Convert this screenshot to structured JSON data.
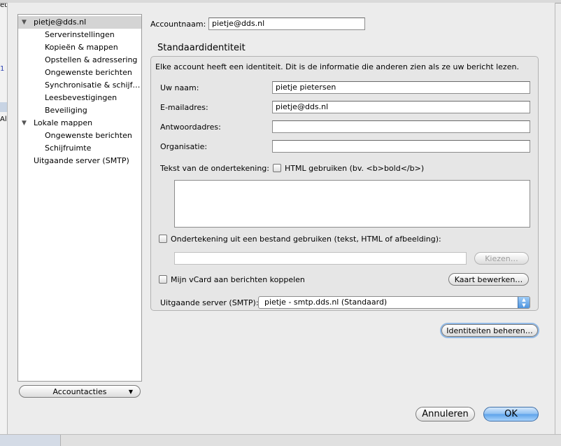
{
  "background": {
    "fragments": [
      "1",
      "All",
      "et"
    ]
  },
  "sidebar": {
    "items": [
      {
        "label": "pietje@dds.nl",
        "level": 0,
        "expanded": true,
        "selected": true
      },
      {
        "label": "Serverinstellingen",
        "level": 1
      },
      {
        "label": "Kopieën & mappen",
        "level": 1
      },
      {
        "label": "Opstellen & adressering",
        "level": 1
      },
      {
        "label": "Ongewenste berichten",
        "level": 1
      },
      {
        "label": "Synchronisatie & schijf…",
        "level": 1
      },
      {
        "label": "Leesbevestigingen",
        "level": 1
      },
      {
        "label": "Beveiliging",
        "level": 1
      },
      {
        "label": "Lokale mappen",
        "level": 0,
        "expanded": true
      },
      {
        "label": "Ongewenste berichten",
        "level": 1
      },
      {
        "label": "Schijfruimte",
        "level": 1
      },
      {
        "label": "Uitgaande server (SMTP)",
        "level": 0
      }
    ],
    "account_actions_label": "Accountacties"
  },
  "account": {
    "name_label": "Accountnaam:",
    "name_value": "pietje@dds.nl"
  },
  "identity": {
    "section_title": "Standaardidentiteit",
    "description": "Elke account heeft een identiteit. Dit is de informatie die anderen zien als ze uw bericht lezen.",
    "fields": {
      "name": {
        "label": "Uw naam:",
        "value": "pietje pietersen"
      },
      "email": {
        "label": "E-mailadres:",
        "value": "pietje@dds.nl"
      },
      "reply_to": {
        "label": "Antwoordadres:",
        "value": ""
      },
      "organization": {
        "label": "Organisatie:",
        "value": ""
      }
    },
    "signature_label": "Tekst van de ondertekening:",
    "use_html_label": "HTML gebruiken (bv. <b>bold</b>)",
    "use_html_checked": false,
    "signature_text": "",
    "signature_file_label": "Ondertekening uit een bestand gebruiken (tekst, HTML of afbeelding):",
    "signature_file_checked": false,
    "signature_file_path": "",
    "choose_button": "Kiezen…",
    "vcard_label": "Mijn vCard aan berichten koppelen",
    "vcard_checked": false,
    "edit_card_button": "Kaart bewerken…",
    "smtp_label": "Uitgaande server (SMTP):",
    "smtp_value": "pietje - smtp.dds.nl (Standaard)"
  },
  "manage_identities_button": "Identiteiten beheren…",
  "footer": {
    "cancel": "Annuleren",
    "ok": "OK"
  },
  "colors": {
    "default_button": "#5ca2ea",
    "selection": "#d4d4d4"
  }
}
